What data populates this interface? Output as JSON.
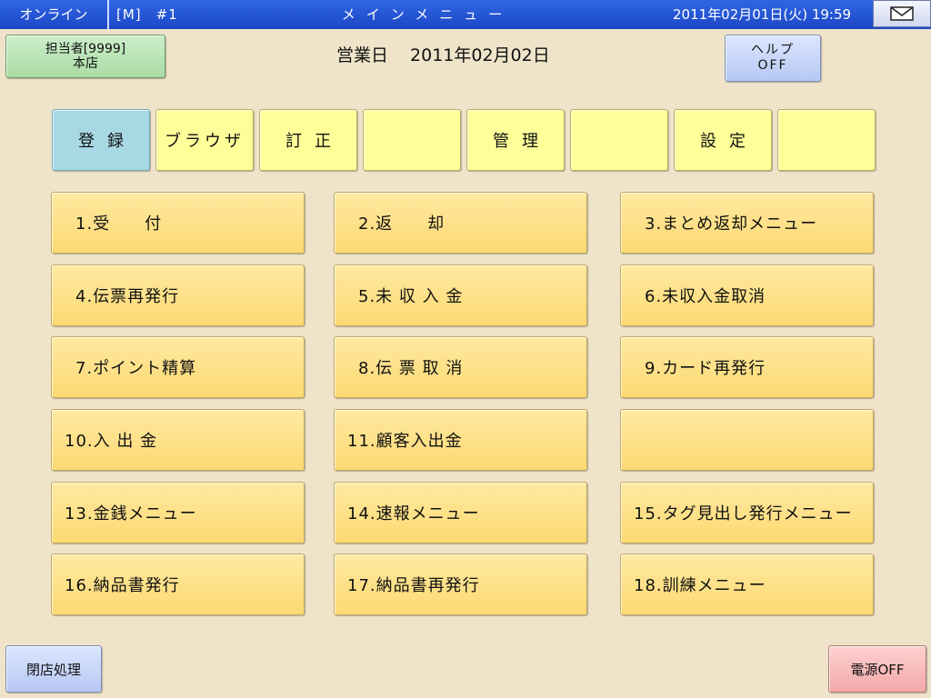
{
  "titlebar": {
    "status": "オンライン",
    "mode_code": "[M]　#1",
    "title": "メインメニュー",
    "datetime": "2011年02月01日(火) 19:59",
    "mail_icon": "mail-icon"
  },
  "staff": {
    "line1": "担当者[9999]",
    "line2": "本店"
  },
  "business_date": {
    "label": "営業日",
    "value": "2011年02月02日"
  },
  "help": {
    "line1": "ヘルプ",
    "line2": "OFF"
  },
  "tabs": [
    {
      "label": "登録",
      "active": true
    },
    {
      "label": "ブラウザ",
      "active": false
    },
    {
      "label": "訂正",
      "active": false
    },
    {
      "label": "",
      "active": false
    },
    {
      "label": "管理",
      "active": false
    },
    {
      "label": "",
      "active": false
    },
    {
      "label": "設定",
      "active": false
    },
    {
      "label": "",
      "active": false
    }
  ],
  "menu": [
    "1.受　　付",
    "2.返　　却",
    "3.まとめ返却メニュー",
    "4.伝票再発行",
    "5.未 収 入 金",
    "6.未収入金取消",
    "7.ポイント精算",
    "8.伝 票 取 消",
    "9.カード再発行",
    "10.入 出 金",
    "11.顧客入出金",
    "",
    "13.金銭メニュー",
    "14.速報メニュー",
    "15.タグ見出し発行メニュー",
    "16.納品書発行",
    "17.納品書再発行",
    "18.訓練メニュー"
  ],
  "footer": {
    "close_store": "閉店処理",
    "power_off": "電源OFF"
  },
  "colors": {
    "background": "#efe4c9",
    "titlebar": "#1c47c6",
    "menu_button": "#fcd972",
    "tab": "#ffff99",
    "tab_active": "#a7d8e4"
  }
}
